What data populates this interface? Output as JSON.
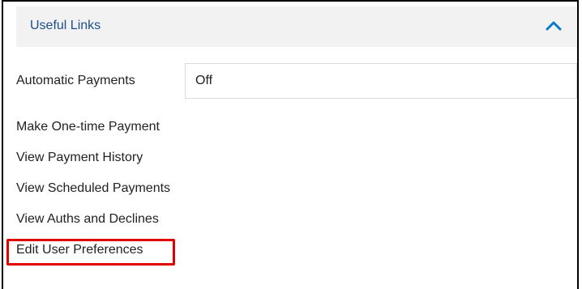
{
  "panel": {
    "title": "Useful Links",
    "collapse_icon": "chevron-up-icon",
    "accent_color": "#0a78c8"
  },
  "automatic_payments": {
    "label": "Automatic Payments",
    "value": "Off"
  },
  "links": [
    {
      "label": "Make One-time Payment"
    },
    {
      "label": "View Payment History"
    },
    {
      "label": "View Scheduled Payments"
    },
    {
      "label": "View Auths and Declines"
    },
    {
      "label": "Edit User Preferences"
    }
  ],
  "highlight_color": "#e00000"
}
